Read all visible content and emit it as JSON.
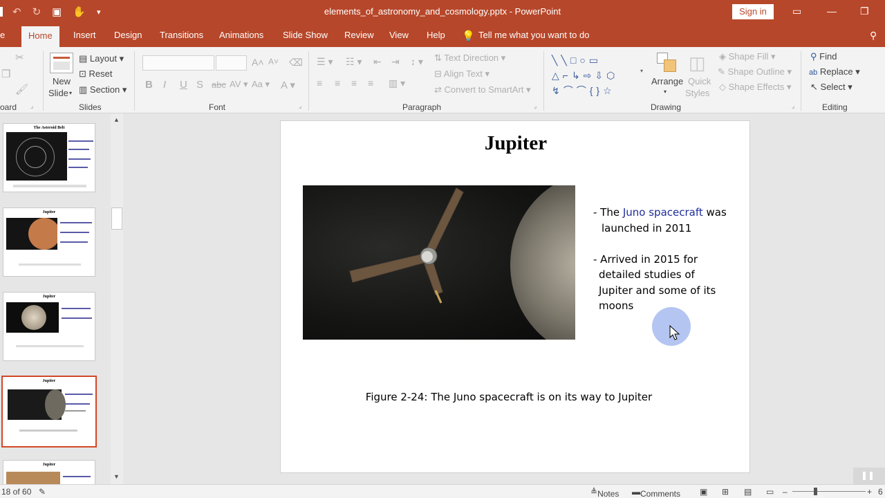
{
  "titlebar": {
    "title": "elements_of_astronomy_and_cosmology.pptx - PowerPoint",
    "signin": "Sign in"
  },
  "tabs": [
    {
      "label": "e"
    },
    {
      "label": "Home"
    },
    {
      "label": "Insert"
    },
    {
      "label": "Design"
    },
    {
      "label": "Transitions"
    },
    {
      "label": "Animations"
    },
    {
      "label": "Slide Show"
    },
    {
      "label": "Review"
    },
    {
      "label": "View"
    },
    {
      "label": "Help"
    }
  ],
  "tellme": "Tell me what you want to do",
  "ribbon": {
    "groups": {
      "clipboard": "oard",
      "slides": "Slides",
      "font": "Font",
      "paragraph": "Paragraph",
      "drawing": "Drawing",
      "editing": "Editing"
    },
    "slides": {
      "new_slide_1": "New",
      "new_slide_2": "Slide",
      "layout": "Layout",
      "reset": "Reset",
      "section": "Section"
    },
    "paragraph": {
      "text_direction": "Text Direction",
      "align_text": "Align Text",
      "convert_smartart": "Convert to SmartArt"
    },
    "drawing": {
      "arrange": "Arrange",
      "quick_1": "Quick",
      "quick_2": "Styles",
      "shape_fill": "Shape Fill",
      "shape_outline": "Shape Outline",
      "shape_effects": "Shape Effects"
    },
    "editing": {
      "find": "Find",
      "replace": "Replace",
      "select": "Select"
    }
  },
  "thumbnails": [
    {
      "title": "The Asteroid Belt"
    },
    {
      "title": "Jupiter"
    },
    {
      "title": "Jupiter"
    },
    {
      "title": "Jupiter"
    },
    {
      "title": "Jupiter"
    }
  ],
  "slide": {
    "title": "Jupiter",
    "bullet1_prefix": "- The ",
    "bullet1_link": "Juno spacecraft",
    "bullet1_suffix": " was",
    "bullet1_line2": "launched in 2011",
    "bullet2_line1": "- Arrived in 2015 for",
    "bullet2_line2": "detailed studies of",
    "bullet2_line3": "Jupiter and some of its",
    "bullet2_line4": "moons",
    "caption": "Figure 2-24: The Juno spacecraft is on its way to Jupiter"
  },
  "status": {
    "slide_count": "18 of 60",
    "notes": "Notes",
    "comments": "Comments",
    "zoom": "6"
  }
}
